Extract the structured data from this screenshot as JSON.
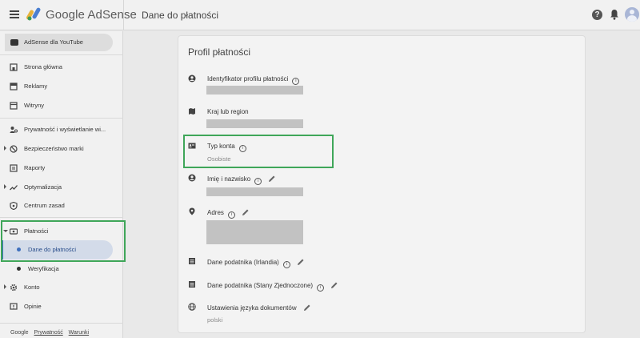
{
  "header": {
    "brand": "Google AdSense",
    "page_title": "Dane do płatności",
    "help_glyph": "?"
  },
  "sidebar": {
    "youtube_label": "AdSense dla YouTube",
    "items": [
      {
        "label": "Strona główna",
        "icon": "home-icon"
      },
      {
        "label": "Reklamy",
        "icon": "ads-icon"
      },
      {
        "label": "Witryny",
        "icon": "sites-icon"
      },
      {
        "label": "Prywatność i wyświetlanie wi...",
        "icon": "privacy-icon"
      },
      {
        "label": "Bezpieczeństwo marki",
        "icon": "block-icon"
      },
      {
        "label": "Raporty",
        "icon": "reports-icon"
      },
      {
        "label": "Optymalizacja",
        "icon": "trend-icon"
      },
      {
        "label": "Centrum zasad",
        "icon": "shield-icon"
      },
      {
        "label": "Płatności",
        "icon": "payments-icon"
      },
      {
        "label": "Konto",
        "icon": "gear-icon"
      },
      {
        "label": "Opinie",
        "icon": "feedback-icon"
      }
    ],
    "sub_items": [
      {
        "label": "Dane do płatności"
      },
      {
        "label": "Weryfikacja"
      }
    ],
    "footer": {
      "google": "Google",
      "privacy": "Prywatność",
      "terms": "Warunki"
    }
  },
  "main": {
    "card_title": "Profil płatności",
    "fields": [
      {
        "label": "Identyfikator profilu płatności",
        "icon": "person-icon"
      },
      {
        "label": "Kraj lub region",
        "icon": "map-icon"
      },
      {
        "label": "Typ konta",
        "value": "Osobiste",
        "icon": "id-card-icon"
      },
      {
        "label": "Imię i nazwisko",
        "icon": "person-icon"
      },
      {
        "label": "Adres",
        "icon": "pin-icon"
      },
      {
        "label": "Dane podatnika (Irlandia)",
        "icon": "document-icon"
      },
      {
        "label": "Dane podatnika (Stany Zjednoczone)",
        "icon": "document-icon"
      },
      {
        "label": "Ustawienia języka dokumentów",
        "value": "polski",
        "icon": "globe-icon"
      }
    ],
    "info_glyph": "i"
  },
  "colors": {
    "highlight": "#3fa659",
    "active_item": "#3e6fbd"
  }
}
